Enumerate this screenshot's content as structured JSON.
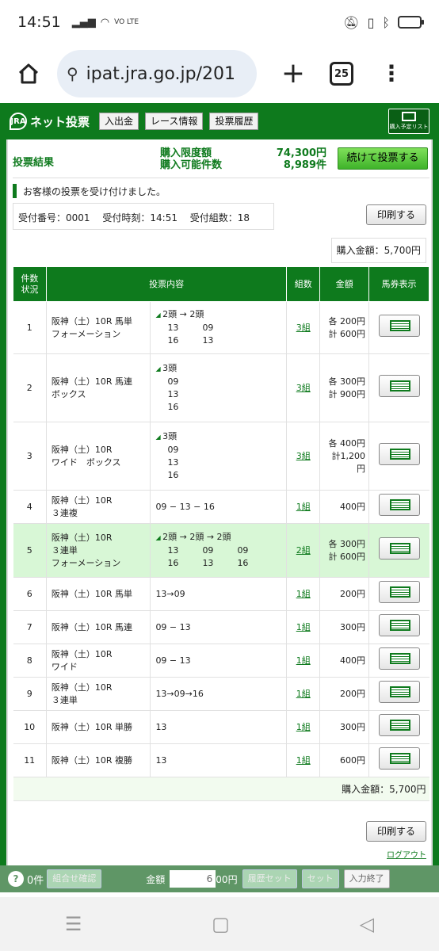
{
  "status_bar": {
    "time": "14:51",
    "network": "VO LTE",
    "icons": [
      "signal-icon",
      "wifi-icon",
      "mute-icon",
      "vibrate-icon",
      "bluetooth-icon",
      "battery-icon"
    ]
  },
  "browser": {
    "url": "ipat.jra.go.jp/201",
    "tab_count": "25"
  },
  "header": {
    "logo_mark": "JRA",
    "logo": "ネット投票",
    "nav": [
      "入出金",
      "レース情報",
      "投票履歴"
    ],
    "list_button": "購入予定リスト"
  },
  "result": {
    "title": "投票結果",
    "limit_label": "購入限度額",
    "count_label": "購入可能件数",
    "limit_value": "74,300円",
    "count_value": "8,989件",
    "continue_button": "続けて投票する",
    "notice": "お客様の投票を受け付けました。",
    "receipt_no": "受付番号：0001",
    "receipt_time": "受付時刻：14:51",
    "receipt_sets": "受付組数：18",
    "print_button": "印刷する",
    "total": "購入金額：5,700円"
  },
  "table": {
    "headers": {
      "num": "件数\n状況",
      "content": "投票内容",
      "kumi": "組数",
      "amount": "金額",
      "ticket": "馬券表示"
    },
    "rows": [
      {
        "no": "1",
        "race": "阪神（土）10R 馬単",
        "type": "フォーメーション",
        "mode": "2頭 → 2頭",
        "lines": [
          [
            "13",
            "09"
          ],
          [
            "16",
            "13"
          ]
        ],
        "kumi": "3組",
        "amt1": "各 200円",
        "amt2": "計 600円"
      },
      {
        "no": "2",
        "race": "阪神（土）10R 馬連",
        "type": "ボックス",
        "mode": "3頭",
        "lines": [
          [
            "09"
          ],
          [
            "13"
          ],
          [
            "16"
          ]
        ],
        "kumi": "3組",
        "amt1": "各 300円",
        "amt2": "計 900円"
      },
      {
        "no": "3",
        "race": "阪神（土）10R",
        "type": "ワイド　ボックス",
        "mode": "3頭",
        "lines": [
          [
            "09"
          ],
          [
            "13"
          ],
          [
            "16"
          ]
        ],
        "kumi": "3組",
        "amt1": "各 400円",
        "amt2": "計1,200円"
      },
      {
        "no": "4",
        "race": "阪神（土）10R",
        "type": "３連複",
        "simple": "09 − 13 − 16",
        "kumi": "1組",
        "amt1": "400円"
      },
      {
        "no": "5",
        "race": "阪神（土）10R",
        "type": "３連単",
        "type2": "フォーメーション",
        "mode": "2頭 → 2頭 → 2頭",
        "lines": [
          [
            "13",
            "09",
            "09"
          ],
          [
            "16",
            "13",
            "16"
          ]
        ],
        "kumi": "2組",
        "amt1": "各 300円",
        "amt2": "計 600円",
        "highlight": true
      },
      {
        "no": "6",
        "race": "阪神（土）10R 馬単",
        "simple": "13→09",
        "kumi": "1組",
        "amt1": "200円"
      },
      {
        "no": "7",
        "race": "阪神（土）10R 馬連",
        "simple": "09 − 13",
        "kumi": "1組",
        "amt1": "300円"
      },
      {
        "no": "8",
        "race": "阪神（土）10R",
        "type": "ワイド",
        "simple": "09 − 13",
        "kumi": "1組",
        "amt1": "400円"
      },
      {
        "no": "9",
        "race": "阪神（土）10R",
        "type": "３連単",
        "simple": "13→09→16",
        "kumi": "1組",
        "amt1": "200円"
      },
      {
        "no": "10",
        "race": "阪神（土）10R 単勝",
        "simple": "13",
        "kumi": "1組",
        "amt1": "300円"
      },
      {
        "no": "11",
        "race": "阪神（土）10R 複勝",
        "simple": "13",
        "kumi": "1組",
        "amt1": "600円"
      }
    ]
  },
  "footer": {
    "logout": "ログアウト"
  },
  "action_bar": {
    "count": "0件",
    "confirm": "組合せ確認",
    "amount_label": "金額",
    "amount_value": "6",
    "amount_unit": "00円",
    "set_all": "履歴セット",
    "set": "セット",
    "end": "入力終了"
  }
}
